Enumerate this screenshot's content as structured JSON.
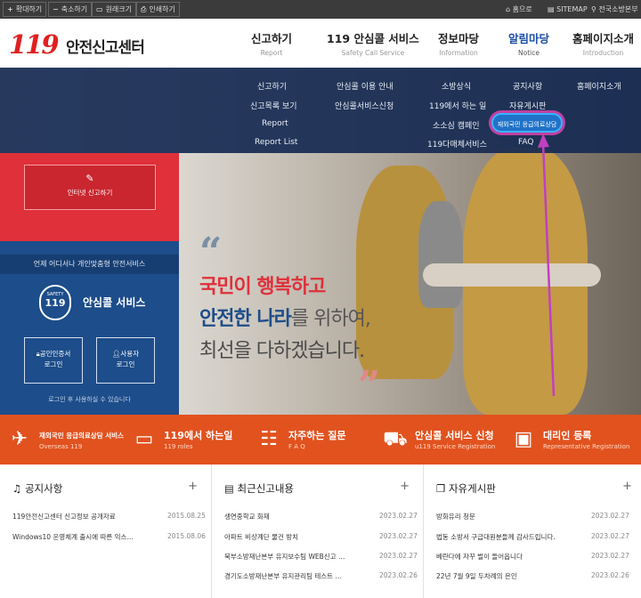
{
  "topbar": {
    "zoom_in": "확대하기",
    "zoom_out": "축소하기",
    "original": "원래크기",
    "print": "인쇄하기",
    "home": "홈으로",
    "sitemap": "SITEMAP",
    "fire_station": "전국소방본부"
  },
  "logo": {
    "mark": "119",
    "name": "안전신고센터"
  },
  "nav": [
    {
      "ko": "신고하기",
      "en": "Report"
    },
    {
      "ko": "119 안심콜 서비스",
      "en": "Safety Call Service"
    },
    {
      "ko": "정보마당",
      "en": "Information"
    },
    {
      "ko": "알림마당",
      "en": "Notice"
    },
    {
      "ko": "홈페이지소개",
      "en": "Introduction"
    }
  ],
  "mega_menu": {
    "col1": [
      "신고하기",
      "신고목록 보기",
      "Report",
      "Report List"
    ],
    "col2": [
      "안심콜 이용 안내",
      "안심콜서비스신청"
    ],
    "col3": [
      "소방상식",
      "119에서 하는 일",
      "소소심 캠페인",
      "119다매체서비스"
    ],
    "col4": [
      "공지사항",
      "자유게시판",
      "재외국민 응급의료상담",
      "FAQ"
    ],
    "col5": [
      "홈페이지소개"
    ]
  },
  "left_panel": {
    "internet_report": "인터넷 신고하기",
    "ansim_header": "언제 어디서나 개인맞춤형 안전서비스",
    "safety_badge_top": "SAFETY",
    "safety_badge_num": "119",
    "ansim_title": "안심콜 서비스",
    "cert_login": "공인인증서\n로그인",
    "user_login": "사용자\n로그인",
    "login_note": "로그인 후 사용하실 수 있습니다"
  },
  "hero": {
    "line1_a": "국민이 ",
    "line1_b": "행복하고",
    "line2_a": "안전한 나라",
    "line2_b": "를 위하여,",
    "line3": "최선을 다하겠습니다."
  },
  "quick_links": [
    {
      "title": "재외국민 응급의료상담 서비스",
      "sub": "Overseas 119",
      "icon": "airplane-icon"
    },
    {
      "title": "119에서 하는일",
      "sub": "119 roles",
      "icon": "monitor-icon"
    },
    {
      "title": "자주하는 질문",
      "sub": "F A Q",
      "icon": "chat-icon"
    },
    {
      "title": "안심콜 서비스 신청",
      "sub": "u119 Service Registration",
      "icon": "ambulance-icon"
    },
    {
      "title": "대리인 등록",
      "sub": "Representative Registration",
      "icon": "id-card-icon"
    }
  ],
  "boards": [
    {
      "title": "공지사항",
      "items": [
        {
          "text": "119안전신고센터 신고정보 공개자료",
          "date": "2015.08.25"
        },
        {
          "text": "Windows10 운영체계 출시에 따른 익스…",
          "date": "2015.08.06"
        }
      ]
    },
    {
      "title": "최근신고내용",
      "items": [
        {
          "text": "생연중학교 화재",
          "date": "2023.02.27"
        },
        {
          "text": "아파트 비상계단 물건 방치",
          "date": "2023.02.27"
        },
        {
          "text": "북부소방재난본부 유지보수팀 WEB신고 …",
          "date": "2023.02.27"
        },
        {
          "text": "경기도소방재난본부 유지관리팀 테스트 …",
          "date": "2023.02.26"
        }
      ]
    },
    {
      "title": "자유게시판",
      "items": [
        {
          "text": "방화유리 청문",
          "date": "2023.02.27"
        },
        {
          "text": "법동 소방서 구급대원분들께 감사드립니다.",
          "date": "2023.02.27"
        },
        {
          "text": "베란다에 자꾸 벌이 들어옵니다",
          "date": "2023.02.27"
        },
        {
          "text": "22년 7월 9일 두차례의 은인",
          "date": "2023.02.26"
        }
      ]
    }
  ],
  "colors": {
    "accent_red": "#e0303a",
    "accent_blue": "#1d4d8a",
    "quick_bar": "#e1521f",
    "nav_active": "#1a4ea8",
    "highlight_pink": "#c040a0"
  }
}
